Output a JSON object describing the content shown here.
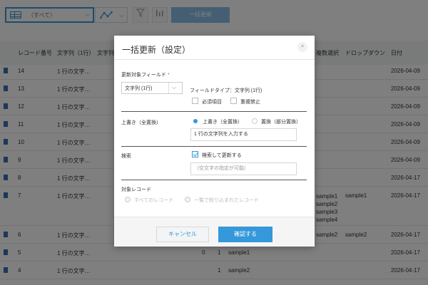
{
  "toolbar": {
    "view_label": "（すべて）",
    "bulk_update_label": "一括更新"
  },
  "table": {
    "headers": [
      "レコード番号",
      "文字列（1行）",
      "文字列",
      "複数選択",
      "ドロップダウン",
      "日付"
    ],
    "rows": [
      {
        "id": "14",
        "text1": "1 行の文字…",
        "date": "2026-04-09"
      },
      {
        "id": "13",
        "text1": "1 行の文字…",
        "date": "2026-04-09"
      },
      {
        "id": "12",
        "text1": "1 行の文字…",
        "date": "2026-04-09"
      },
      {
        "id": "11",
        "text1": "1 行の文字…",
        "date": "2026-04-09"
      },
      {
        "id": "10",
        "text1": "1 行の文字…",
        "date": "2026-04-09"
      },
      {
        "id": "9",
        "text1": "1 行の文字…",
        "date": "2026-04-09"
      },
      {
        "id": "8",
        "text1": "1 行の文字…",
        "date": "2026-04-17"
      },
      {
        "id": "7",
        "text1": "1 行の文字…",
        "multi": "sample1\nsample2\nsample3\nsample4",
        "dropdown": "sample1",
        "date": "2026-04-17"
      },
      {
        "id": "6",
        "text1": "1 行の文字…",
        "multi": "sample2",
        "dropdown": "sample2",
        "date": "2026-04-17"
      },
      {
        "id": "5",
        "text1": "1 行の文字…",
        "n1": "0",
        "n2": "1",
        "mid": "sample1",
        "date": "2026-04-17"
      },
      {
        "id": "4",
        "text1": "1 行の文字…",
        "n2": "1",
        "mid": "sample2",
        "date": "2026-04-17"
      }
    ]
  },
  "dialog": {
    "title": "一括更新（設定）",
    "close_label": "×",
    "target_field_label": "更新対象フィールド",
    "required_mark": "*",
    "field_select_value": "文字列 (1行)",
    "field_type_text": "フィールドタイプ：文字列 (1行)",
    "required_checkbox": "必須項目",
    "unique_checkbox": "重複禁止",
    "overwrite_section_label": "上書き（全置換）",
    "radio_overwrite": "上書き（全置換）",
    "radio_replace": "置換（部分置換）",
    "overwrite_value": "1 行の文字列を入力する",
    "search_section_label": "検索",
    "search_checkbox": "検索して更新する",
    "search_placeholder": "（空文字の指定が可能）",
    "target_records_label": "対象レコード",
    "radio_all_records": "すべてのレコード",
    "radio_filtered_records": "一覧で絞り込まれたレコード",
    "cancel_label": "キャンセル",
    "confirm_label": "確認する"
  }
}
